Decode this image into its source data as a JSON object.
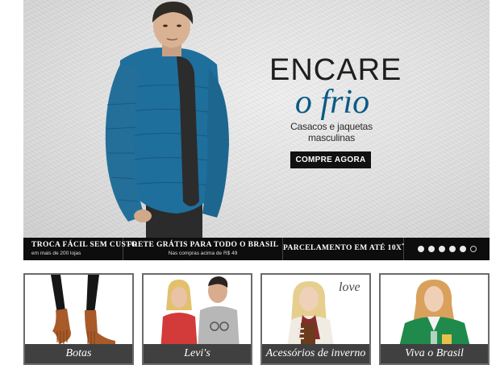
{
  "hero": {
    "headline_line1": "ENCARE",
    "headline_line2": "o frio",
    "subheadline": "Casacos e jaquetas masculinas",
    "cta_label": "COMPRE AGORA",
    "accent_color": "#0a5a86"
  },
  "info_bar": {
    "items": [
      {
        "title": "TROCA FÁCIL SEM CUSTO",
        "subtitle": "em mais de 200 lojas"
      },
      {
        "title": "FRETE GRÁTIS PARA TODO O BRASIL",
        "subtitle": "Nas compras acima de R$ 49"
      },
      {
        "title": "PARCELAMENTO EM ATÉ 10X",
        "subtitle": ""
      }
    ],
    "title_suffix": "*",
    "slider": {
      "count": 6,
      "active_index": 5
    }
  },
  "categories": [
    {
      "label": "Botas"
    },
    {
      "label": "Levi's"
    },
    {
      "label": "Acessórios de inverno",
      "logo_text": "love"
    },
    {
      "label": "Viva o Brasil"
    }
  ]
}
